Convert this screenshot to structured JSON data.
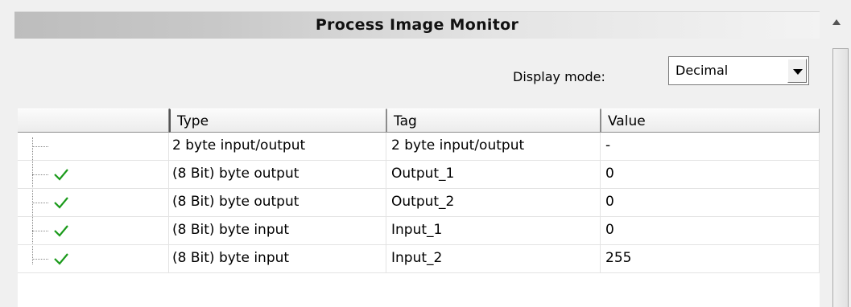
{
  "header": {
    "title": "Process Image Monitor"
  },
  "display_mode": {
    "label": "Display mode:",
    "selected": "Decimal"
  },
  "table": {
    "columns": [
      "",
      "Type",
      "Tag",
      "Value"
    ],
    "rows": [
      {
        "type": "2 byte input/output",
        "tag": "2 byte input/output",
        "value": "-",
        "status_icon": ""
      },
      {
        "type": "(8 Bit) byte output",
        "tag": "Output_1",
        "value": "0",
        "status_icon": "checkmark-icon"
      },
      {
        "type": "(8 Bit) byte output",
        "tag": "Output_2",
        "value": "0",
        "status_icon": "checkmark-icon"
      },
      {
        "type": "(8 Bit) byte input",
        "tag": "Input_1",
        "value": "0",
        "status_icon": "checkmark-icon"
      },
      {
        "type": "(8 Bit) byte input",
        "tag": "Input_2",
        "value": "255",
        "status_icon": "checkmark-icon"
      }
    ]
  },
  "colors": {
    "check": "#1a9a1a",
    "title_bar_start": "#bdbdbd",
    "title_bar_end": "#f3f3f3"
  }
}
